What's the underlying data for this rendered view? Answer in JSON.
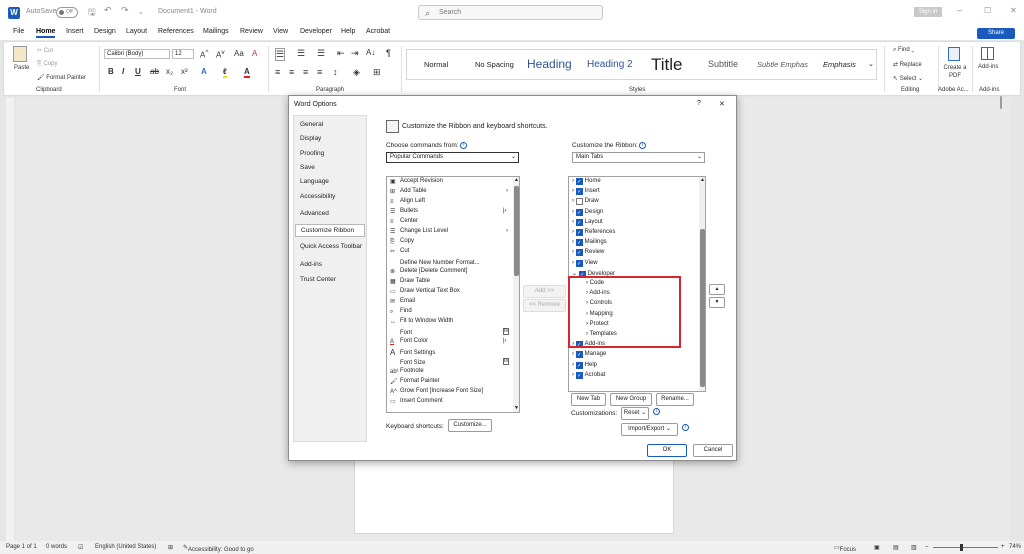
{
  "titlebar": {
    "autosave": "AutoSave",
    "toggle": "Off",
    "doc_title": "Document1 - Word",
    "search_placeholder": "Search",
    "sign_in": "Sign in"
  },
  "tabs": [
    "File",
    "Home",
    "Insert",
    "Design",
    "Layout",
    "References",
    "Mailings",
    "Review",
    "View",
    "Developer",
    "Help",
    "Acrobat"
  ],
  "share": "Share",
  "ribbon": {
    "clipboard": {
      "paste": "Paste",
      "cut": "Cut",
      "copy": "Copy",
      "format_painter": "Format Painter",
      "label": "Clipboard"
    },
    "font": {
      "name": "Calibri (Body)",
      "size": "12",
      "label": "Font"
    },
    "paragraph": {
      "label": "Paragraph"
    },
    "styles": {
      "items": [
        "Normal",
        "No Spacing",
        "Heading",
        "Heading 2",
        "Title",
        "Subtitle",
        "Subtle Emphas",
        "Emphasis"
      ],
      "label": "Styles"
    },
    "editing": {
      "find": "Find",
      "replace": "Replace",
      "select": "Select",
      "label": "Editing"
    },
    "acrobat": {
      "create": "Create a PDF",
      "label": "Adobe Ac..."
    },
    "addins": {
      "btn": "Add-ins",
      "label": "Add-ins"
    }
  },
  "dialog": {
    "title": "Word Options",
    "help": "?",
    "close": "✕",
    "nav": [
      "General",
      "Display",
      "Proofing",
      "Save",
      "Language",
      "Accessibility",
      "Advanced",
      "Customize Ribbon",
      "Quick Access Toolbar",
      "Add-ins",
      "Trust Center"
    ],
    "header": "Customize the Ribbon and keyboard shortcuts.",
    "choose_label": "Choose commands from:",
    "choose_value": "Popular Commands",
    "customize_label": "Customize the Ribbon:",
    "customize_value": "Main Tabs",
    "commands": [
      "Accept Revision",
      "Add Table",
      "Align Left",
      "Bullets",
      "Center",
      "Change List Level",
      "Copy",
      "Cut",
      "Define New Number Format...",
      "Delete [Delete Comment]",
      "Draw Table",
      "Draw Vertical Text Box",
      "Email",
      "Find",
      "Fit to Window Width",
      "Font",
      "Font Color",
      "Font Settings",
      "Font Size",
      "Footnote",
      "Format Painter",
      "Grow Font [Increase Font Size]",
      "Insert Comment"
    ],
    "tree": [
      {
        "label": "Home",
        "level": 0,
        "checked": true
      },
      {
        "label": "Insert",
        "level": 0,
        "checked": true
      },
      {
        "label": "Draw",
        "level": 0,
        "checked": false
      },
      {
        "label": "Design",
        "level": 0,
        "checked": true
      },
      {
        "label": "Layout",
        "level": 0,
        "checked": true
      },
      {
        "label": "References",
        "level": 0,
        "checked": true
      },
      {
        "label": "Mailings",
        "level": 0,
        "checked": true
      },
      {
        "label": "Review",
        "level": 0,
        "checked": true
      },
      {
        "label": "View",
        "level": 0,
        "checked": true
      },
      {
        "label": "Developer",
        "level": 0,
        "checked": true
      },
      {
        "label": "Code",
        "level": 1
      },
      {
        "label": "Add-ins",
        "level": 1
      },
      {
        "label": "Controls",
        "level": 1
      },
      {
        "label": "Mapping",
        "level": 1
      },
      {
        "label": "Protect",
        "level": 1
      },
      {
        "label": "Templates",
        "level": 1
      },
      {
        "label": "Add-ins",
        "level": 0,
        "checked": true
      },
      {
        "label": "Manage",
        "level": 0,
        "checked": true
      },
      {
        "label": "Help",
        "level": 0,
        "checked": true
      },
      {
        "label": "Acrobat",
        "level": 0,
        "checked": true
      }
    ],
    "add_btn": "Add >>",
    "remove_btn": "<< Remove",
    "new_tab": "New Tab",
    "new_group": "New Group",
    "rename": "Rename...",
    "customizations": "Customizations:",
    "reset": "Reset",
    "import_export": "Import/Export",
    "keyboard": "Keyboard shortcuts:",
    "customize_btn": "Customize...",
    "ok": "OK",
    "cancel": "Cancel"
  },
  "status": {
    "page": "Page 1 of 1",
    "words": "0 words",
    "lang": "English (United States)",
    "access": "Accessibility: Good to go",
    "focus": "Focus",
    "zoom": "74%"
  }
}
